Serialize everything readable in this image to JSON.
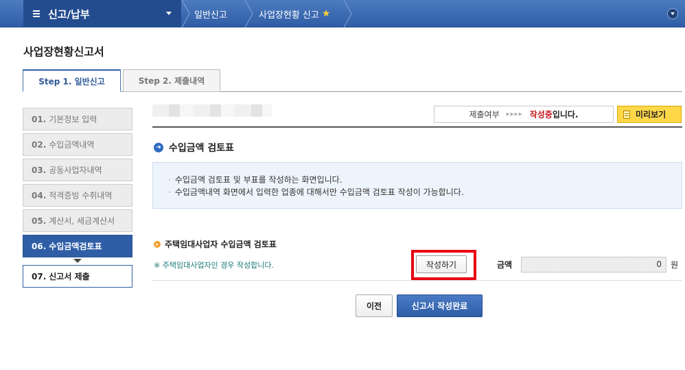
{
  "topbar": {
    "menu_title": "신고/납부",
    "breadcrumbs": [
      "일반신고",
      "사업장현황 신고"
    ],
    "star_icon": "star-icon",
    "expand_icon": "chevron-down-icon"
  },
  "page_title": "사업장현황신고서",
  "tabs": [
    {
      "label": "Step 1. 일반신고",
      "active": true
    },
    {
      "label": "Step 2. 제출내역",
      "active": false
    }
  ],
  "steps": [
    {
      "num": "01.",
      "label": "기본정보 입력"
    },
    {
      "num": "02.",
      "label": "수입금액내역"
    },
    {
      "num": "03.",
      "label": "공동사업자내역"
    },
    {
      "num": "04.",
      "label": "적격증빙 수취내역"
    },
    {
      "num": "05.",
      "label": "계산서, 세금계산서"
    },
    {
      "num": "06.",
      "label": "수입금액검토표"
    },
    {
      "num": "07.",
      "label": "신고서 제출"
    }
  ],
  "status": {
    "label": "제출여부",
    "arrows": "▸▸▸▸",
    "value": "작성중",
    "suffix": "입니다."
  },
  "preview_label": "미리보기",
  "section": {
    "title": "수입금액 검토표",
    "info": [
      "수입금액 검토표 및 부표를 작성하는 화면입니다.",
      "수입금액내역 화면에서 입력한 업종에 대해서만 수입금액 검토표 작성이 가능합니다."
    ]
  },
  "subsection": {
    "title": "주택임대사업자 수입금액 검토표",
    "note": "※ 주택임대사업자인 경우 작성합니다.",
    "write_label": "작성하기",
    "amount_label": "금액",
    "amount_value": "0",
    "unit": "원"
  },
  "buttons": {
    "prev": "이전",
    "complete": "신고서 작성완료"
  },
  "colors": {
    "accent": "#2f5ea6",
    "status_red": "#c4161c",
    "preview_yellow": "#ffd84a",
    "highlight_red": "#e60012"
  }
}
